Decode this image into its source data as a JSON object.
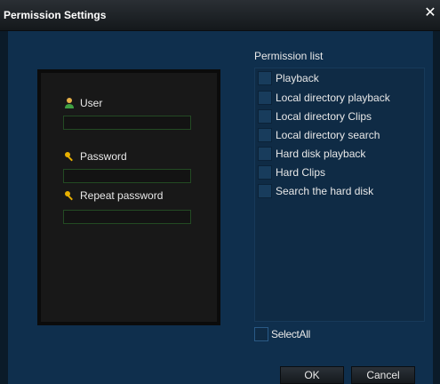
{
  "window": {
    "title": "Permission Settings",
    "close_glyph": "✕"
  },
  "form": {
    "user_label": "User",
    "user_value": "",
    "password_label": "Password",
    "password_value": "",
    "repeat_password_label": "Repeat password",
    "repeat_password_value": ""
  },
  "permissions": {
    "title": "Permission list",
    "items": [
      {
        "label": "Playback",
        "checked": false
      },
      {
        "label": "Local directory playback",
        "checked": false
      },
      {
        "label": "Local directory Clips",
        "checked": false
      },
      {
        "label": "Local directory search",
        "checked": false
      },
      {
        "label": "Hard disk playback",
        "checked": false
      },
      {
        "label": "Hard Clips",
        "checked": false
      },
      {
        "label": "Search the hard disk",
        "checked": false
      }
    ],
    "select_all_label": "SelectAll",
    "select_all_checked": false
  },
  "buttons": {
    "ok": "OK",
    "cancel": "Cancel"
  },
  "icons": {
    "user": "user-icon",
    "key": "key-icon",
    "close": "close-icon"
  },
  "colors": {
    "background": "#0f2f4d",
    "titlebar": "#1c2125",
    "panel": "#181818",
    "field_border": "#234a23",
    "list_background": "#0f2b45"
  }
}
